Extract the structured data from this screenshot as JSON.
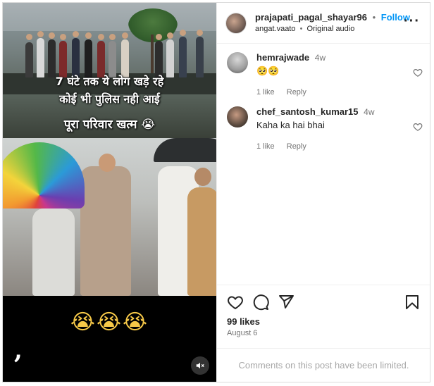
{
  "media": {
    "caption_line1": "7 घंटे तक ये लोग खड़े रहे",
    "caption_line2": "कोई भी पुलिस नही आई",
    "caption_line3": "पूरा परिवार खत्म 😭",
    "bottom_emojis": "😭😭😭",
    "comma_glyph": ",",
    "mute_icon": "muted-speaker-icon"
  },
  "header": {
    "username": "prajapati_pagal_shayar96",
    "separator": "•",
    "follow_label": "Follow",
    "audio_user": "angat.vaato",
    "audio_label": "Original audio",
    "more_label": "···"
  },
  "comments": [
    {
      "username": "hemrajwade",
      "time": "4w",
      "text": "🥺🥺",
      "likes_label": "1 like",
      "reply_label": "Reply"
    },
    {
      "username": "chef_santosh_kumar15",
      "time": "4w",
      "text": "Kaha ka hai bhai",
      "likes_label": "1 like",
      "reply_label": "Reply"
    }
  ],
  "actions": {
    "likes": "99 likes",
    "date": "August 6",
    "limited_notice": "Comments on this post have been limited."
  },
  "colors": {
    "accent": "#0095f6",
    "muted_text": "#737373"
  }
}
